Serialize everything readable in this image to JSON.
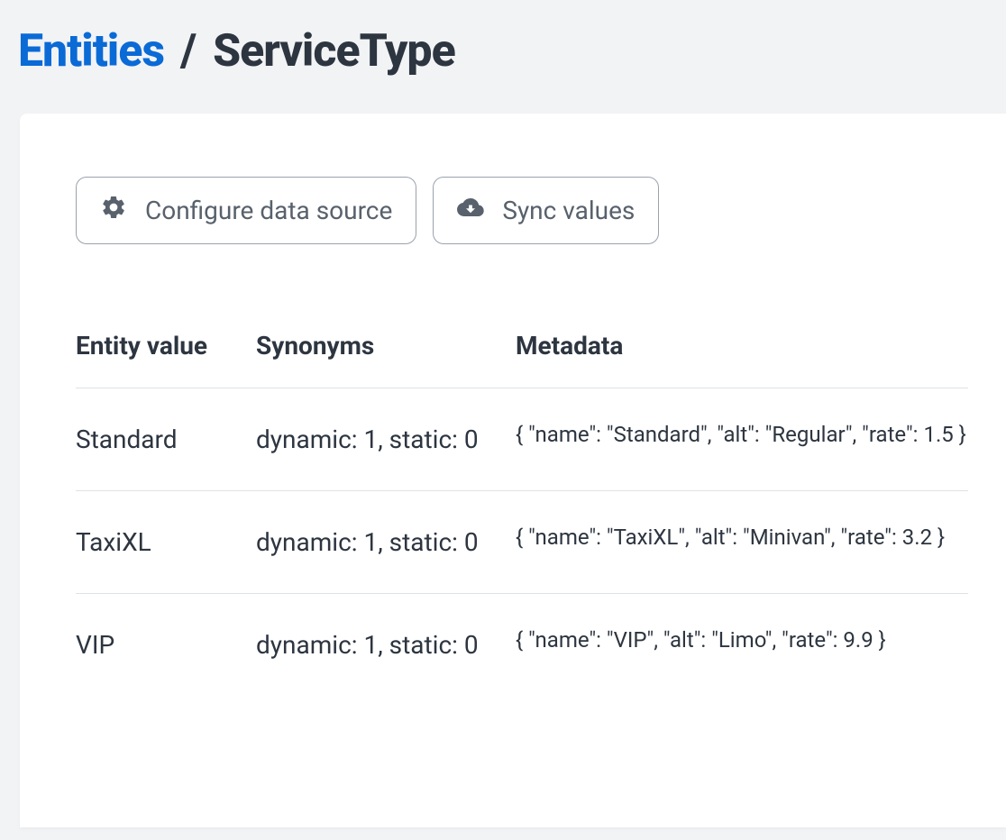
{
  "breadcrumb": {
    "parent": "Entities",
    "separator": "/",
    "current": "ServiceType"
  },
  "buttons": {
    "configure": "Configure data source",
    "sync": "Sync values"
  },
  "table": {
    "headers": {
      "entity": "Entity value",
      "synonyms": "Synonyms",
      "metadata": "Metadata"
    },
    "rows": [
      {
        "entity": "Standard",
        "synonyms": "dynamic: 1, static: 0",
        "metadata": "{ \"name\": \"Standard\", \"alt\": \"Regular\", \"rate\": 1.5 }"
      },
      {
        "entity": "TaxiXL",
        "synonyms": "dynamic: 1, static: 0",
        "metadata": "{ \"name\": \"TaxiXL\", \"alt\": \"Minivan\", \"rate\": 3.2 }"
      },
      {
        "entity": "VIP",
        "synonyms": "dynamic: 1, static: 0",
        "metadata": "{ \"name\": \"VIP\", \"alt\": \"Limo\", \"rate\": 9.9 }"
      }
    ]
  }
}
